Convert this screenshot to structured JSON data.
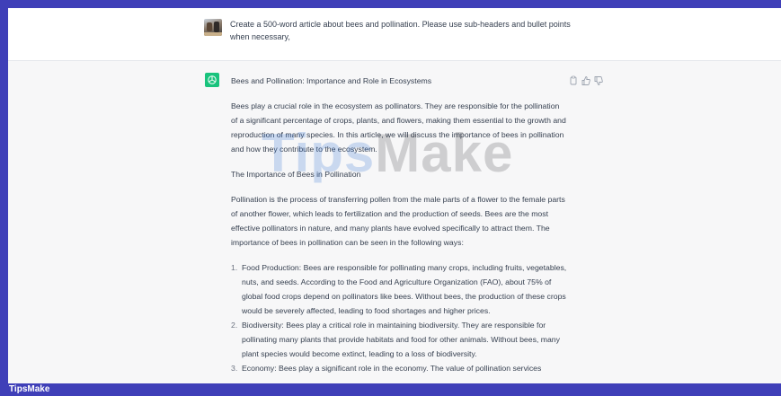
{
  "user_message": {
    "text": "Create a 500-word article about bees and pollination. Please use sub-headers and bullet points when necessary,"
  },
  "assistant": {
    "title": "Bees and Pollination: Importance and Role in Ecosystems",
    "intro": "Bees play a crucial role in the ecosystem as pollinators. They are responsible for the pollination of a significant percentage of crops, plants, and flowers, making them essential to the growth and reproduction of many species. In this article, we will discuss the importance of bees in pollination and how they contribute to the ecosystem.",
    "subheader": "The Importance of Bees in Pollination",
    "paragraph2": "Pollination is the process of transferring pollen from the male parts of a flower to the female parts of another flower, which leads to fertilization and the production of seeds. Bees are the most effective pollinators in nature, and many plants have evolved specifically to attract them. The importance of bees in pollination can be seen in the following ways:",
    "list": [
      {
        "num": "1.",
        "text": "Food Production: Bees are responsible for pollinating many crops, including fruits, vegetables, nuts, and seeds. According to the Food and Agriculture Organization (FAO), about 75% of global food crops depend on pollinators like bees. Without bees, the production of these crops would be severely affected, leading to food shortages and higher prices."
      },
      {
        "num": "2.",
        "text": "Biodiversity: Bees play a critical role in maintaining biodiversity. They are responsible for pollinating many plants that provide habitats and food for other animals. Without bees, many plant species would become extinct, leading to a loss of biodiversity."
      },
      {
        "num": "3.",
        "text": "Economy: Bees play a significant role in the economy. The value of pollination services"
      }
    ]
  },
  "actions": {
    "icons": [
      "copy-icon",
      "thumbs-up-icon",
      "thumbs-down-icon"
    ]
  },
  "watermark": {
    "part1": "Tips",
    "part2": "Make"
  },
  "brand": {
    "label": "TipsMake"
  },
  "colors": {
    "frame": "#3f3fb8",
    "gpt_avatar": "#19c37d",
    "assistant_bg": "#f7f7f8"
  }
}
